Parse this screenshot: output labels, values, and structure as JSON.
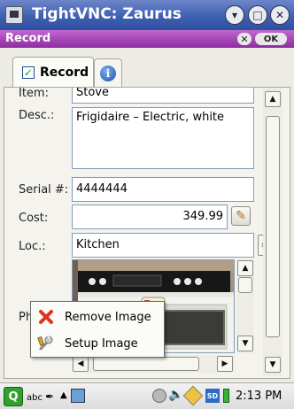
{
  "window": {
    "title": "TightVNC: Zaurus"
  },
  "dialog": {
    "title": "Record",
    "ok_label": "OK",
    "close_label": "✕"
  },
  "tabs": [
    {
      "label": "Record"
    }
  ],
  "form": {
    "item_label": "Item:",
    "item_value": "Stove",
    "desc_label": "Desc.:",
    "desc_value": "Frigidaire – Electric, white",
    "serial_label": "Serial #:",
    "serial_value": "4444444",
    "cost_label": "Cost:",
    "cost_value": "349.99",
    "loc_label": "Loc.:",
    "loc_value": "Kitchen",
    "photo_label_visible": "Ph"
  },
  "context_menu": {
    "items": [
      {
        "label": "Remove Image",
        "icon": "red-x-icon"
      },
      {
        "label": "Setup Image",
        "icon": "wrench-icon"
      }
    ]
  },
  "taskbar": {
    "ime_label": "abc",
    "clock": "2:13 PM"
  },
  "colors": {
    "title_blue": "#3f5fb2",
    "dialog_purple": "#8e2ca0",
    "panel_bg": "#f4f3ee",
    "field_border": "#7f9db9"
  }
}
